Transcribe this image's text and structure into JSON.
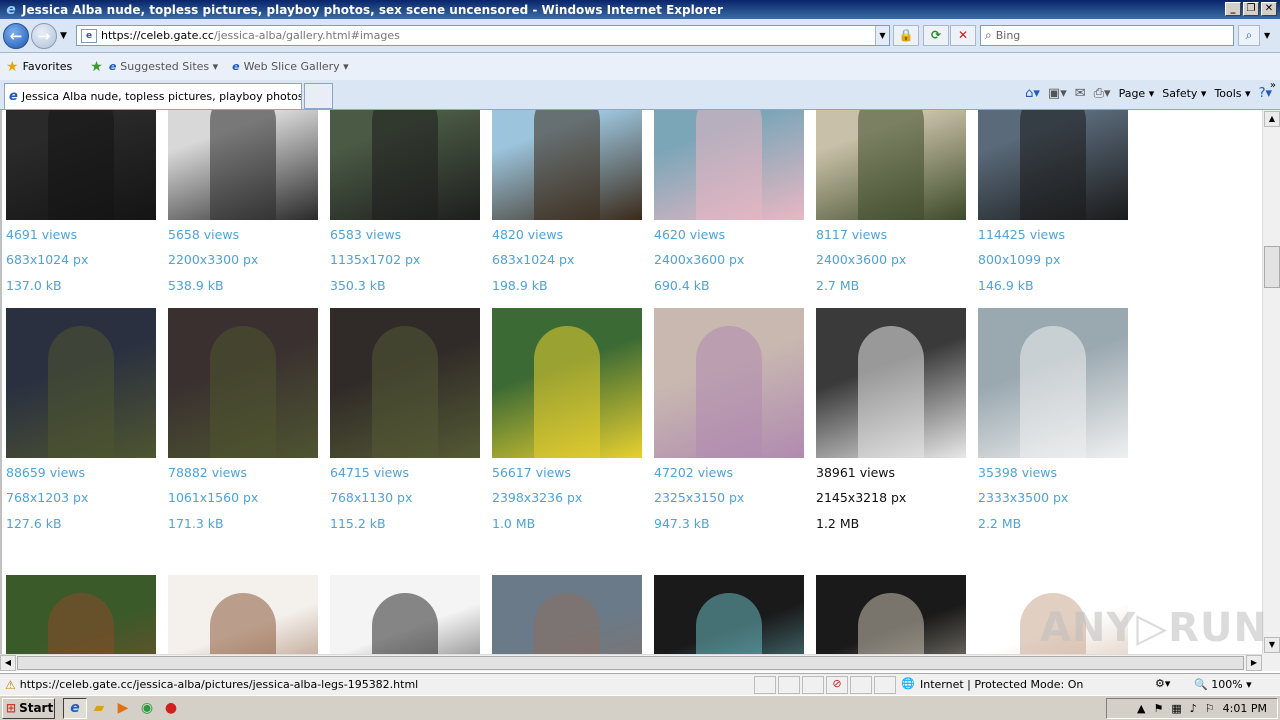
{
  "window": {
    "title": "Jessica Alba nude, topless pictures, playboy photos, sex scene uncensored - Windows Internet Explorer",
    "controls": [
      "_",
      "❐",
      "✕"
    ]
  },
  "nav": {
    "url_prefix": "https://",
    "url_host": "celeb.gate.cc",
    "url_path": "/jessica-alba/gallery.html#images",
    "search_placeholder": "Bing"
  },
  "favorites": {
    "favorites_label": "Favorites",
    "suggested_sites_label": "Suggested Sites ▾",
    "web_slice_label": "Web Slice Gallery ▾"
  },
  "tab": {
    "label": "Jessica Alba nude, topless pictures, playboy photos, ..."
  },
  "command_bar": {
    "page_label": "Page ▾",
    "safety_label": "Safety ▾",
    "tools_label": "Tools ▾"
  },
  "gallery": {
    "rows": [
      {
        "items": [
          {
            "views": "4691 views",
            "dims": "683x1024 px",
            "size": "137.0 kB",
            "colors": [
              "#2a2a2a",
              "#141414"
            ],
            "visited": false
          },
          {
            "views": "5658 views",
            "dims": "2200x3300 px",
            "size": "538.9 kB",
            "colors": [
              "#d8d8d8",
              "#2a2a2a"
            ],
            "visited": false
          },
          {
            "views": "6583 views",
            "dims": "1135x1702 px",
            "size": "350.3 kB",
            "colors": [
              "#4a5a44",
              "#1e1e1e"
            ],
            "visited": false
          },
          {
            "views": "4820 views",
            "dims": "683x1024 px",
            "size": "198.9 kB",
            "colors": [
              "#9cc4dc",
              "#3a2a1a"
            ],
            "visited": false
          },
          {
            "views": "4620 views",
            "dims": "2400x3600 px",
            "size": "690.4 kB",
            "colors": [
              "#7aa6b8",
              "#e9b7c3"
            ],
            "visited": false
          },
          {
            "views": "8117 views",
            "dims": "2400x3600 px",
            "size": "2.7 MB",
            "colors": [
              "#c8c0a8",
              "#3d4a2a"
            ],
            "visited": false
          },
          {
            "views": "114425 views",
            "dims": "800x1099 px",
            "size": "146.9 kB",
            "colors": [
              "#5a6a7a",
              "#1a1a1a"
            ],
            "visited": false
          }
        ]
      },
      {
        "items": [
          {
            "views": "88659 views",
            "dims": "768x1203 px",
            "size": "127.6 kB",
            "colors": [
              "#2a3040",
              "#4e5530"
            ],
            "visited": false
          },
          {
            "views": "78882 views",
            "dims": "1061x1560 px",
            "size": "171.3 kB",
            "colors": [
              "#3a3030",
              "#4e5530"
            ],
            "visited": false
          },
          {
            "views": "64715 views",
            "dims": "768x1130 px",
            "size": "115.2 kB",
            "colors": [
              "#302a28",
              "#545a34"
            ],
            "visited": false
          },
          {
            "views": "56617 views",
            "dims": "2398x3236 px",
            "size": "1.0 MB",
            "colors": [
              "#3c6a34",
              "#e8d030"
            ],
            "visited": false
          },
          {
            "views": "47202 views",
            "dims": "2325x3150 px",
            "size": "947.3 kB",
            "colors": [
              "#c8b8b0",
              "#b08ab0"
            ],
            "visited": false
          },
          {
            "views": "38961 views",
            "dims": "2145x3218 px",
            "size": "1.2 MB",
            "colors": [
              "#3a3a3a",
              "#e8e8e8"
            ],
            "visited": true
          },
          {
            "views": "35398 views",
            "dims": "2333x3500 px",
            "size": "2.2 MB",
            "colors": [
              "#9aa8b0",
              "#f0f0f0"
            ],
            "visited": false
          }
        ]
      },
      {
        "items": [
          {
            "colors": [
              "#3a5a2a",
              "#8a4a2a"
            ]
          },
          {
            "colors": [
              "#f4f0ec",
              "#8a5a3a"
            ]
          },
          {
            "colors": [
              "#f4f4f4",
              "#2a2a2a"
            ]
          },
          {
            "colors": [
              "#6a7a88",
              "#8a7060"
            ]
          },
          {
            "colors": [
              "#1a1a1a",
              "#6ab8c0"
            ]
          },
          {
            "colors": [
              "#1a1a1a",
              "#c8c0b0"
            ]
          },
          {
            "colors": [
              "#ffffff",
              "#c8a890"
            ]
          }
        ]
      }
    ]
  },
  "status_bar": {
    "url": "https://celeb.gate.cc/jessica-alba/pictures/jessica-alba-legs-195382.html",
    "zone": "Internet | Protected Mode: On",
    "zoom": "100%"
  },
  "taskbar": {
    "start_label": "Start",
    "clock": "4:01 PM"
  },
  "watermark": "ANY▷RUN"
}
